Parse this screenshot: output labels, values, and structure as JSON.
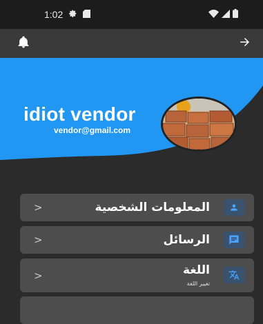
{
  "status_bar": {
    "time": "1:02"
  },
  "header": {
    "name": "idiot vendor",
    "email": "vendor@gmail.com",
    "accent_color": "#2196F3"
  },
  "menu": [
    {
      "label": "المعلومات الشخصية",
      "icon": "person-icon"
    },
    {
      "label": "الرسائل",
      "icon": "chat-icon"
    },
    {
      "label": "اللغة",
      "subtitle": "تغيير اللغة",
      "icon": "translate-icon"
    }
  ]
}
